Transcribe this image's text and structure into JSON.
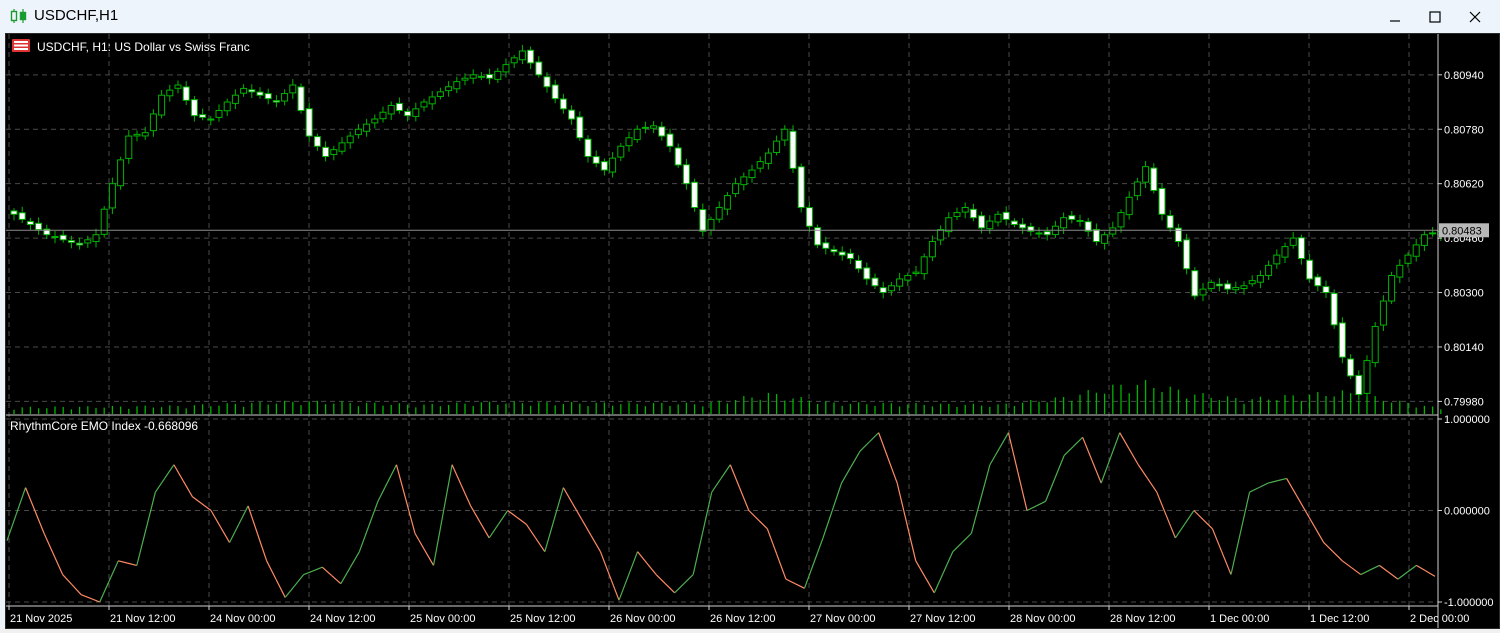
{
  "window": {
    "title": "USDCHF,H1",
    "minimize_label": "minimize",
    "maximize_label": "maximize",
    "close_label": "close"
  },
  "chart": {
    "header": "USDCHF, H1:  US Dollar vs Swiss Franc",
    "current_price": "0.80483",
    "indicator_label": "RhythmCore EMO Index -0.668096"
  },
  "colors": {
    "background": "#000000",
    "grid": "#4a4a4a",
    "candle_bull_body": "#000000",
    "candle_bear_body": "#ffffff",
    "candle_outline": "#00b400",
    "volume": "#00b400",
    "indicator_up": "#4caf50",
    "indicator_down": "#ff8a65"
  },
  "chart_data": [
    {
      "type": "candlestick",
      "title": "USDCHF, H1:  US Dollar vs Swiss Franc",
      "price_axis_ticks": [
        "0.80940",
        "0.80780",
        "0.80620",
        "0.80460",
        "0.80300",
        "0.80140",
        "0.79980"
      ],
      "ylim": [
        0.7994,
        0.8106
      ],
      "time_axis_ticks": [
        "21 Nov 2025",
        "21 Nov 12:00",
        "24 Nov 00:00",
        "24 Nov 12:00",
        "25 Nov 00:00",
        "25 Nov 12:00",
        "26 Nov 00:00",
        "26 Nov 12:00",
        "27 Nov 00:00",
        "27 Nov 12:00",
        "28 Nov 00:00",
        "28 Nov 12:00",
        "1 Dec 00:00",
        "1 Dec 12:00",
        "2 Dec 00:00"
      ],
      "current_price": 0.80483,
      "close_anchors": [
        [
          0,
          0.8053
        ],
        [
          4,
          0.8047
        ],
        [
          8,
          0.8044
        ],
        [
          10,
          0.8047
        ],
        [
          12,
          0.8062
        ],
        [
          14,
          0.8076
        ],
        [
          16,
          0.8077
        ],
        [
          18,
          0.8088
        ],
        [
          20,
          0.8091
        ],
        [
          22,
          0.8082
        ],
        [
          24,
          0.8081
        ],
        [
          26,
          0.8086
        ],
        [
          28,
          0.809
        ],
        [
          30,
          0.8088
        ],
        [
          32,
          0.8086
        ],
        [
          34,
          0.8091
        ],
        [
          36,
          0.8076
        ],
        [
          38,
          0.807
        ],
        [
          40,
          0.8074
        ],
        [
          42,
          0.8078
        ],
        [
          44,
          0.8081
        ],
        [
          46,
          0.8085
        ],
        [
          48,
          0.8082
        ],
        [
          50,
          0.8086
        ],
        [
          52,
          0.8089
        ],
        [
          54,
          0.8092
        ],
        [
          56,
          0.8094
        ],
        [
          58,
          0.8093
        ],
        [
          60,
          0.8097
        ],
        [
          62,
          0.8101
        ],
        [
          64,
          0.8094
        ],
        [
          66,
          0.8087
        ],
        [
          68,
          0.8081
        ],
        [
          70,
          0.807
        ],
        [
          72,
          0.8066
        ],
        [
          74,
          0.8073
        ],
        [
          76,
          0.8078
        ],
        [
          78,
          0.8079
        ],
        [
          80,
          0.8073
        ],
        [
          82,
          0.8062
        ],
        [
          84,
          0.8048
        ],
        [
          86,
          0.8055
        ],
        [
          88,
          0.8062
        ],
        [
          90,
          0.8066
        ],
        [
          92,
          0.8071
        ],
        [
          94,
          0.8078
        ],
        [
          96,
          0.8055
        ],
        [
          98,
          0.8044
        ],
        [
          100,
          0.8042
        ],
        [
          102,
          0.804
        ],
        [
          104,
          0.8034
        ],
        [
          106,
          0.803
        ],
        [
          108,
          0.8034
        ],
        [
          110,
          0.8036
        ],
        [
          112,
          0.8045
        ],
        [
          114,
          0.8052
        ],
        [
          116,
          0.8055
        ],
        [
          118,
          0.8049
        ],
        [
          120,
          0.8053
        ],
        [
          122,
          0.805
        ],
        [
          124,
          0.8048
        ],
        [
          126,
          0.8047
        ],
        [
          128,
          0.8052
        ],
        [
          130,
          0.8051
        ],
        [
          132,
          0.8045
        ],
        [
          134,
          0.8049
        ],
        [
          136,
          0.8058
        ],
        [
          138,
          0.8067
        ],
        [
          140,
          0.8053
        ],
        [
          142,
          0.8045
        ],
        [
          144,
          0.8029
        ],
        [
          146,
          0.8033
        ],
        [
          148,
          0.8031
        ],
        [
          150,
          0.8032
        ],
        [
          152,
          0.8035
        ],
        [
          154,
          0.8041
        ],
        [
          156,
          0.8046
        ],
        [
          158,
          0.8034
        ],
        [
          160,
          0.803
        ],
        [
          162,
          0.8011
        ],
        [
          164,
          0.8
        ],
        [
          166,
          0.802
        ],
        [
          168,
          0.8035
        ],
        [
          170,
          0.8041
        ],
        [
          172,
          0.8047
        ],
        [
          174,
          0.8048
        ]
      ],
      "volume_relative": [
        [
          0,
          0.18
        ],
        [
          20,
          0.22
        ],
        [
          35,
          0.35
        ],
        [
          50,
          0.25
        ],
        [
          58,
          0.32
        ],
        [
          68,
          0.3
        ],
        [
          84,
          0.28
        ],
        [
          92,
          0.55
        ],
        [
          100,
          0.3
        ],
        [
          120,
          0.25
        ],
        [
          128,
          0.45
        ],
        [
          134,
          0.75
        ],
        [
          138,
          0.85
        ],
        [
          144,
          0.55
        ],
        [
          150,
          0.4
        ],
        [
          162,
          0.6
        ],
        [
          174,
          0.15
        ]
      ]
    },
    {
      "type": "line",
      "title": "RhythmCore EMO Index -0.668096",
      "axis_ticks": [
        "1.000000",
        "0.000000",
        "-1.000000"
      ],
      "ylim": [
        -1,
        1
      ],
      "series": [
        {
          "values_anchors": [
            [
              0,
              -0.33
            ],
            [
              2,
              0.25
            ],
            [
              4,
              -0.25
            ],
            [
              6,
              -0.7
            ],
            [
              8,
              -0.92
            ],
            [
              10,
              -1.0
            ],
            [
              12,
              -0.55
            ],
            [
              14,
              -0.6
            ],
            [
              16,
              0.2
            ],
            [
              18,
              0.5
            ],
            [
              20,
              0.15
            ],
            [
              22,
              0.0
            ],
            [
              24,
              -0.35
            ],
            [
              26,
              0.05
            ],
            [
              28,
              -0.55
            ],
            [
              30,
              -0.95
            ],
            [
              32,
              -0.7
            ],
            [
              34,
              -0.62
            ],
            [
              36,
              -0.8
            ],
            [
              38,
              -0.45
            ],
            [
              40,
              0.1
            ],
            [
              42,
              0.5
            ],
            [
              44,
              -0.25
            ],
            [
              46,
              -0.6
            ],
            [
              48,
              0.5
            ],
            [
              50,
              0.05
            ],
            [
              52,
              -0.3
            ],
            [
              54,
              0.0
            ],
            [
              56,
              -0.15
            ],
            [
              58,
              -0.45
            ],
            [
              60,
              0.25
            ],
            [
              62,
              -0.1
            ],
            [
              64,
              -0.45
            ],
            [
              66,
              -0.98
            ],
            [
              68,
              -0.45
            ],
            [
              70,
              -0.7
            ],
            [
              72,
              -0.9
            ],
            [
              74,
              -0.7
            ],
            [
              76,
              0.2
            ],
            [
              78,
              0.5
            ],
            [
              80,
              0.0
            ],
            [
              82,
              -0.2
            ],
            [
              84,
              -0.75
            ],
            [
              86,
              -0.85
            ],
            [
              88,
              -0.3
            ],
            [
              90,
              0.3
            ],
            [
              92,
              0.65
            ],
            [
              94,
              0.85
            ],
            [
              96,
              0.3
            ],
            [
              98,
              -0.55
            ],
            [
              100,
              -0.9
            ],
            [
              102,
              -0.45
            ],
            [
              104,
              -0.25
            ],
            [
              106,
              0.5
            ],
            [
              108,
              0.85
            ],
            [
              110,
              0.0
            ],
            [
              112,
              0.1
            ],
            [
              114,
              0.6
            ],
            [
              116,
              0.8
            ],
            [
              118,
              0.3
            ],
            [
              120,
              0.85
            ],
            [
              122,
              0.5
            ],
            [
              124,
              0.2
            ],
            [
              126,
              -0.3
            ],
            [
              128,
              0.0
            ],
            [
              130,
              -0.2
            ],
            [
              132,
              -0.7
            ],
            [
              134,
              0.2
            ],
            [
              136,
              0.3
            ],
            [
              138,
              0.35
            ],
            [
              140,
              0.0
            ],
            [
              142,
              -0.35
            ],
            [
              144,
              -0.55
            ],
            [
              146,
              -0.7
            ],
            [
              148,
              -0.6
            ],
            [
              150,
              -0.75
            ],
            [
              152,
              -0.6
            ],
            [
              154,
              -0.72
            ]
          ]
        }
      ]
    }
  ]
}
